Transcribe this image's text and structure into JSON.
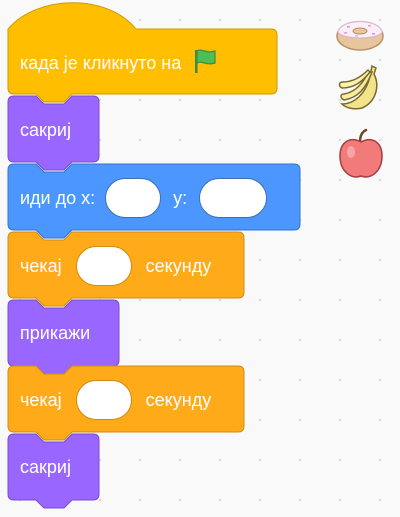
{
  "blocks": {
    "when_flag": "када је кликнуто на",
    "hide_1": "сакриј",
    "goto_prefix": "иди до x:",
    "goto_y": "y:",
    "wait_1_prefix": "чекај",
    "wait_1_suffix": "секунду",
    "show": "прикажи",
    "wait_2_prefix": "чекај",
    "wait_2_suffix": "секунду",
    "hide_2": "сакриј"
  },
  "inputs": {
    "goto_x": "",
    "goto_y": "",
    "wait_1": "",
    "wait_2": ""
  },
  "sprites": [
    "donut-icon",
    "bananas-icon",
    "apple-icon"
  ],
  "colors": {
    "events": "#ffbf00",
    "looks": "#9966ff",
    "motion": "#4c97ff",
    "control": "#ffab19",
    "flag": "#4cbf56"
  }
}
